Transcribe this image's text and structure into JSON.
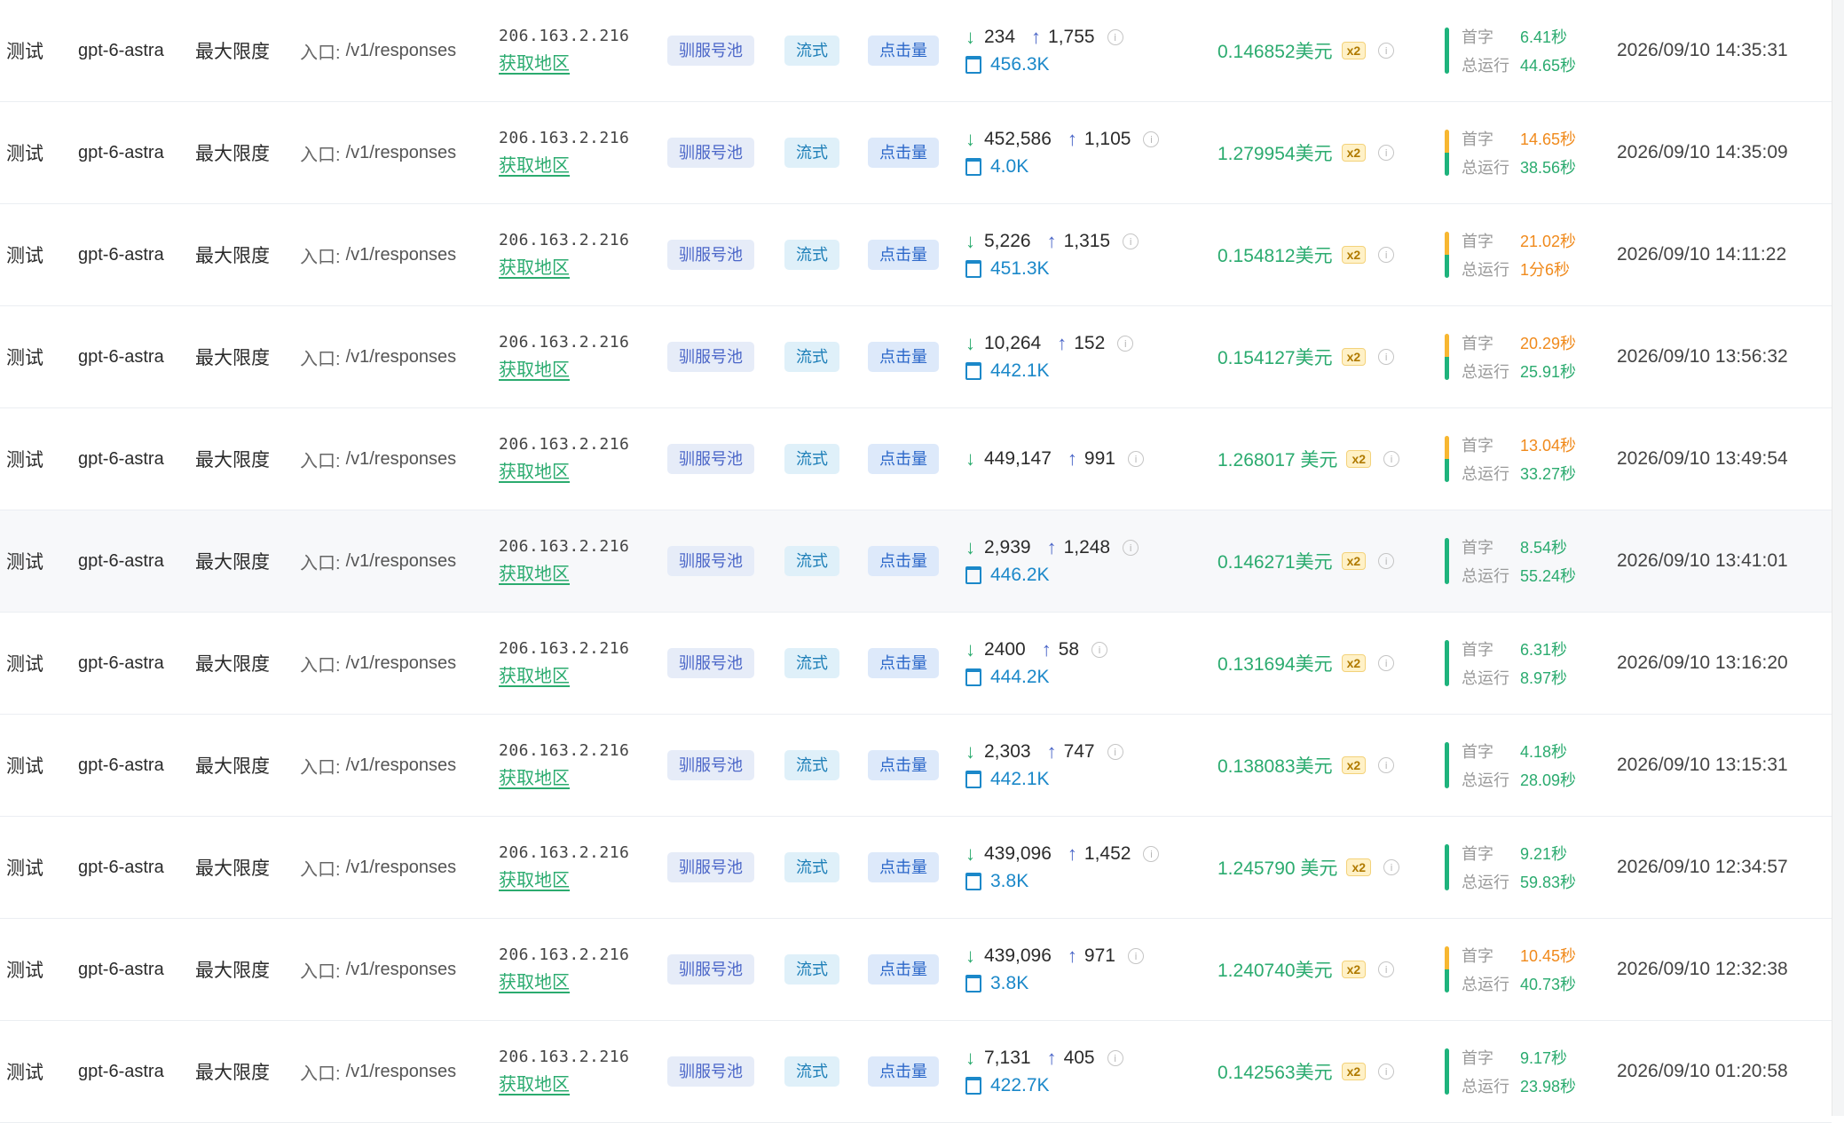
{
  "labels": {
    "entry_label": "入口:",
    "region_link": "获取地区",
    "first_label": "首字",
    "total_label": "总运行",
    "multiplier": "x2"
  },
  "rows": [
    {
      "name": "测试",
      "model": "gpt-6-astra",
      "reasoning": "最大限度",
      "entry": "/v1/responses",
      "ip": "206.163.2.216",
      "tags": [
        "驯服号池",
        "流式",
        "点击量"
      ],
      "tokens_in": "234",
      "tokens_out": "1,755",
      "cache": "456.3K",
      "cost": "0.146852美元",
      "first": "6.41秒",
      "total": "44.65秒",
      "first_color": "green",
      "bar": "green",
      "time": "2026/09/10 14:35:31",
      "highlighted": false
    },
    {
      "name": "测试",
      "model": "gpt-6-astra",
      "reasoning": "最大限度",
      "entry": "/v1/responses",
      "ip": "206.163.2.216",
      "tags": [
        "驯服号池",
        "流式",
        "点击量"
      ],
      "tokens_in": "452,586",
      "tokens_out": "1,105",
      "cache": "4.0K",
      "cost": "1.279954美元",
      "first": "14.65秒",
      "total": "38.56秒",
      "first_color": "orange",
      "bar": "mix",
      "time": "2026/09/10 14:35:09",
      "highlighted": false
    },
    {
      "name": "测试",
      "model": "gpt-6-astra",
      "reasoning": "最大限度",
      "entry": "/v1/responses",
      "ip": "206.163.2.216",
      "tags": [
        "驯服号池",
        "流式",
        "点击量"
      ],
      "tokens_in": "5,226",
      "tokens_out": "1,315",
      "cache": "451.3K",
      "cost": "0.154812美元",
      "first": "21.02秒",
      "total": "1分6秒",
      "first_color": "orange",
      "total_color": "orange",
      "bar": "mix",
      "time": "2026/09/10 14:11:22",
      "highlighted": false
    },
    {
      "name": "测试",
      "model": "gpt-6-astra",
      "reasoning": "最大限度",
      "entry": "/v1/responses",
      "ip": "206.163.2.216",
      "tags": [
        "驯服号池",
        "流式",
        "点击量"
      ],
      "tokens_in": "10,264",
      "tokens_out": "152",
      "cache": "442.1K",
      "cost": "0.154127美元",
      "first": "20.29秒",
      "total": "25.91秒",
      "first_color": "orange",
      "bar": "mix",
      "time": "2026/09/10 13:56:32",
      "highlighted": false
    },
    {
      "name": "测试",
      "model": "gpt-6-astra",
      "reasoning": "最大限度",
      "entry": "/v1/responses",
      "ip": "206.163.2.216",
      "tags": [
        "驯服号池",
        "流式",
        "点击量"
      ],
      "tokens_in": "449,147",
      "tokens_out": "991",
      "cache": "",
      "cost": "1.268017 美元",
      "first": "13.04秒",
      "total": "33.27秒",
      "first_color": "orange",
      "bar": "mix",
      "time": "2026/09/10 13:49:54",
      "highlighted": false
    },
    {
      "name": "测试",
      "model": "gpt-6-astra",
      "reasoning": "最大限度",
      "entry": "/v1/responses",
      "ip": "206.163.2.216",
      "tags": [
        "驯服号池",
        "流式",
        "点击量"
      ],
      "tokens_in": "2,939",
      "tokens_out": "1,248",
      "cache": "446.2K",
      "cost": "0.146271美元",
      "first": "8.54秒",
      "total": "55.24秒",
      "first_color": "green",
      "bar": "green",
      "time": "2026/09/10 13:41:01",
      "highlighted": true
    },
    {
      "name": "测试",
      "model": "gpt-6-astra",
      "reasoning": "最大限度",
      "entry": "/v1/responses",
      "ip": "206.163.2.216",
      "tags": [
        "驯服号池",
        "流式",
        "点击量"
      ],
      "tokens_in": "2400",
      "tokens_out": "58",
      "cache": "444.2K",
      "cost": "0.131694美元",
      "first": "6.31秒",
      "total": "8.97秒",
      "first_color": "green",
      "bar": "green",
      "time": "2026/09/10 13:16:20",
      "highlighted": false
    },
    {
      "name": "测试",
      "model": "gpt-6-astra",
      "reasoning": "最大限度",
      "entry": "/v1/responses",
      "ip": "206.163.2.216",
      "tags": [
        "驯服号池",
        "流式",
        "点击量"
      ],
      "tokens_in": "2,303",
      "tokens_out": "747",
      "cache": "442.1K",
      "cost": "0.138083美元",
      "first": "4.18秒",
      "total": "28.09秒",
      "first_color": "green",
      "bar": "green",
      "time": "2026/09/10 13:15:31",
      "highlighted": false
    },
    {
      "name": "测试",
      "model": "gpt-6-astra",
      "reasoning": "最大限度",
      "entry": "/v1/responses",
      "ip": "206.163.2.216",
      "tags": [
        "驯服号池",
        "流式",
        "点击量"
      ],
      "tokens_in": "439,096",
      "tokens_out": "1,452",
      "cache": "3.8K",
      "cost": "1.245790 美元",
      "first": "9.21秒",
      "total": "59.83秒",
      "first_color": "green",
      "bar": "green",
      "time": "2026/09/10 12:34:57",
      "highlighted": false
    },
    {
      "name": "测试",
      "model": "gpt-6-astra",
      "reasoning": "最大限度",
      "entry": "/v1/responses",
      "ip": "206.163.2.216",
      "tags": [
        "驯服号池",
        "流式",
        "点击量"
      ],
      "tokens_in": "439,096",
      "tokens_out": "971",
      "cache": "3.8K",
      "cost": "1.240740美元",
      "first": "10.45秒",
      "total": "40.73秒",
      "first_color": "orange",
      "bar": "mix",
      "time": "2026/09/10 12:32:38",
      "highlighted": false
    },
    {
      "name": "测试",
      "model": "gpt-6-astra",
      "reasoning": "最大限度",
      "entry": "/v1/responses",
      "ip": "206.163.2.216",
      "tags": [
        "驯服号池",
        "流式",
        "点击量"
      ],
      "tokens_in": "7,131",
      "tokens_out": "405",
      "cache": "422.7K",
      "cost": "0.142563美元",
      "first": "9.17秒",
      "total": "23.98秒",
      "first_color": "green",
      "bar": "green",
      "time": "2026/09/10 01:20:58",
      "highlighted": false
    }
  ]
}
